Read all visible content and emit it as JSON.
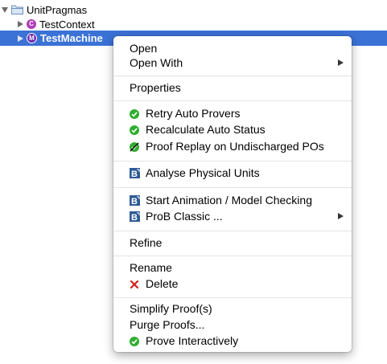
{
  "tree": {
    "root_label": "UnitPragmas",
    "context_label": "TestContext",
    "machine_label": "TestMachine",
    "context_letter": "C",
    "machine_letter": "M"
  },
  "menu": {
    "open": "Open",
    "open_with": "Open With",
    "properties": "Properties",
    "retry_auto_provers": "Retry Auto Provers",
    "recalculate_auto_status": "Recalculate Auto Status",
    "proof_replay": "Proof Replay on Undischarged POs",
    "analyse_physical_units": "Analyse Physical Units",
    "start_animation": "Start Animation / Model Checking",
    "prob_classic": "ProB Classic ...",
    "refine": "Refine",
    "rename": "Rename",
    "delete": "Delete",
    "simplify_proofs": "Simplify Proof(s)",
    "purge_proofs": "Purge Proofs...",
    "prove_interactively": "Prove Interactively"
  },
  "colors": {
    "selection": "#3b72d6",
    "check_green": "#2fae2f",
    "delete_red": "#d0201a",
    "prob_blue": "#2d5a96"
  },
  "icons": [
    "folder-icon",
    "context-icon",
    "machine-icon",
    "check-icon",
    "proof-replay-icon",
    "prob-icon",
    "delete-icon",
    "chevron-right-icon"
  ]
}
